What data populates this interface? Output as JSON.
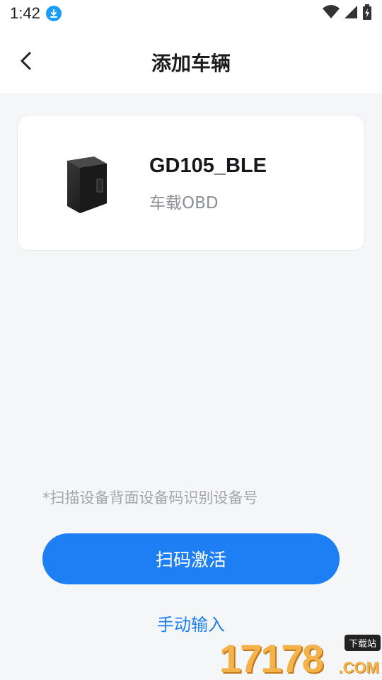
{
  "status_bar": {
    "time": "1:42"
  },
  "header": {
    "title": "添加车辆"
  },
  "device": {
    "name": "GD105_BLE",
    "type": "车载OBD"
  },
  "hint": "*扫描设备背面设备码识别设备号",
  "actions": {
    "scan_label": "扫码激活",
    "manual_label": "手动输入"
  },
  "watermark": {
    "digits": "17178",
    "badge": "下载站",
    "suffix": ".COM"
  },
  "colors": {
    "accent": "#1e7ff4",
    "background": "#f5f6f8"
  }
}
